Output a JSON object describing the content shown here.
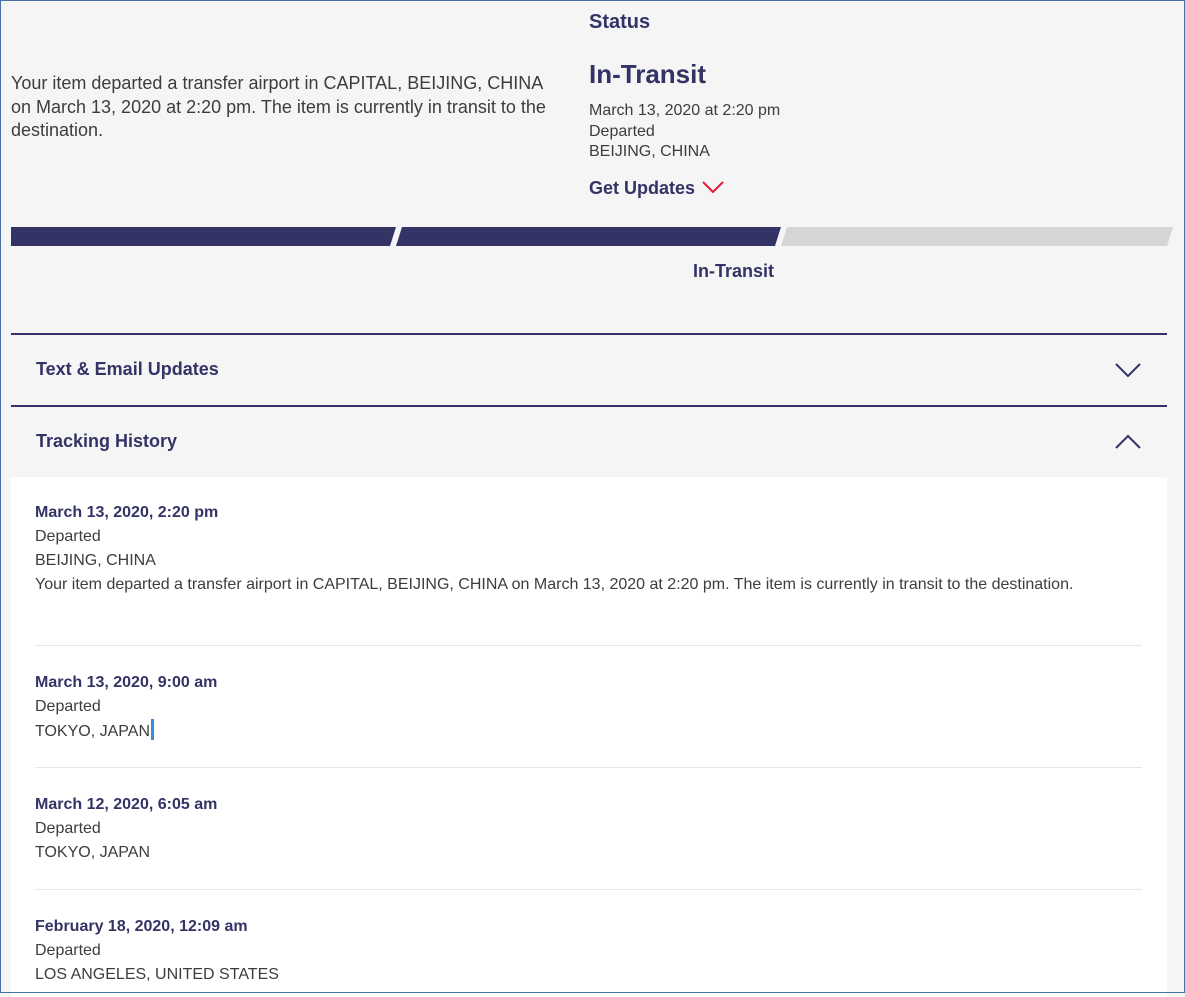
{
  "summary": {
    "message": "Your item departed a transfer airport in CAPITAL, BEIJING, CHINA on March 13, 2020 at 2:20 pm. The item is currently in transit to the destination."
  },
  "status": {
    "label": "Status",
    "value": "In-Transit",
    "datetime": "March 13, 2020 at 2:20 pm",
    "event": "Departed",
    "location": "BEIJING, CHINA",
    "get_updates_label": "Get Updates"
  },
  "progress": {
    "current_label": "In-Transit",
    "completed_steps": 2,
    "total_steps": 3,
    "colors": {
      "complete": "#333366",
      "incomplete": "#d6d6d6"
    }
  },
  "sections": {
    "text_email": {
      "title": "Text & Email Updates",
      "expanded": false
    },
    "tracking_history": {
      "title": "Tracking History",
      "expanded": true
    }
  },
  "history": [
    {
      "date": "March 13, 2020, 2:20 pm",
      "status": "Departed",
      "location": "BEIJING, CHINA",
      "detail": "Your item departed a transfer airport in CAPITAL, BEIJING, CHINA on March 13, 2020 at 2:20 pm. The item is currently in transit to the destination."
    },
    {
      "date": "March 13, 2020, 9:00 am",
      "status": "Departed",
      "location": "TOKYO, JAPAN"
    },
    {
      "date": "March 12, 2020, 6:05 am",
      "status": "Departed",
      "location": "TOKYO, JAPAN"
    },
    {
      "date": "February 18, 2020, 12:09 am",
      "status": "Departed",
      "location": "LOS ANGELES, UNITED STATES"
    }
  ],
  "icons": {
    "get_updates": "chevron-down-icon",
    "text_email": "chevron-down-icon",
    "tracking_history": "chevron-up-icon"
  },
  "colors": {
    "brand": "#333366",
    "accent": "#e31837",
    "background": "#f5f5f5",
    "text": "#3d3d3d"
  }
}
